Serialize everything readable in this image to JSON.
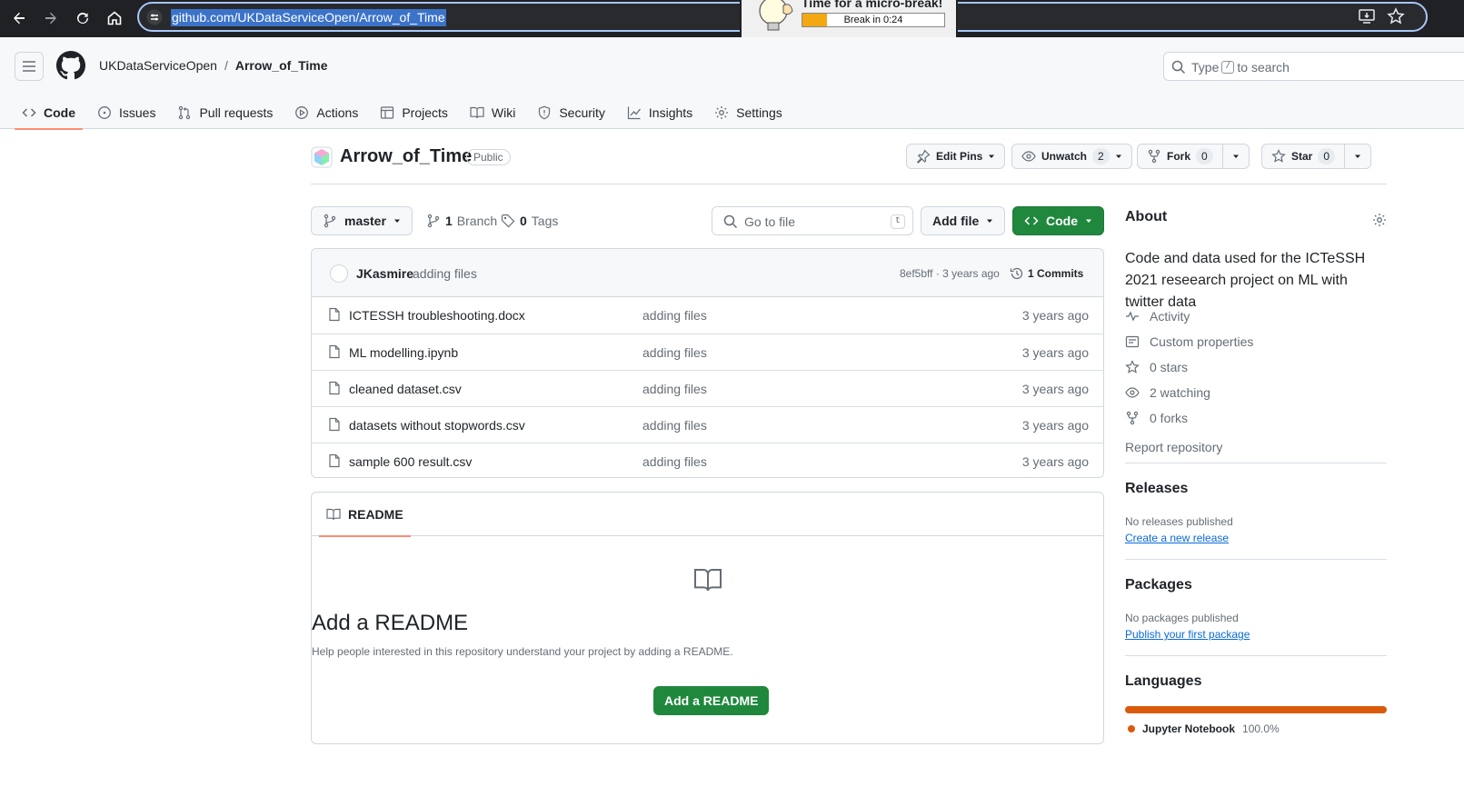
{
  "browser": {
    "url": "github.com/UKDataServiceOpen/Arrow_of_Time"
  },
  "popup": {
    "title": "Time for a micro-break!",
    "progress_text": "Break in 0:24",
    "progress_fraction": 0.17,
    "fill_color": "#f3a712"
  },
  "header": {
    "owner": "UKDataServiceOpen",
    "separator": "/",
    "repo": "Arrow_of_Time",
    "search_prefix": "Type",
    "search_key": "/",
    "search_suffix": "to search"
  },
  "tabs": [
    {
      "label": "Code",
      "icon": "code-icon",
      "active": true
    },
    {
      "label": "Issues",
      "icon": "issue-icon"
    },
    {
      "label": "Pull requests",
      "icon": "pull-request-icon"
    },
    {
      "label": "Actions",
      "icon": "play-icon"
    },
    {
      "label": "Projects",
      "icon": "table-icon"
    },
    {
      "label": "Wiki",
      "icon": "book-icon"
    },
    {
      "label": "Security",
      "icon": "shield-icon"
    },
    {
      "label": "Insights",
      "icon": "graph-icon"
    },
    {
      "label": "Settings",
      "icon": "gear-icon"
    }
  ],
  "repo": {
    "name": "Arrow_of_Time",
    "visibility": "Public",
    "edit_pins": "Edit Pins",
    "unwatch": "Unwatch",
    "watch_count": "2",
    "fork": "Fork",
    "fork_count": "0",
    "star": "Star",
    "star_count": "0"
  },
  "toolbar": {
    "branch": "master",
    "branch_count": "1",
    "branch_label": "Branch",
    "tag_count": "0",
    "tag_label": "Tags",
    "goto_placeholder": "Go to file",
    "goto_key": "t",
    "add_file": "Add file",
    "code": "Code"
  },
  "commit": {
    "author": "JKasmire",
    "message": "adding files",
    "meta": "8ef5bff · 3 years ago",
    "count": "1 Commits"
  },
  "files": [
    {
      "name": "ICTESSH troubleshooting.docx",
      "message": "adding files",
      "date": "3 years ago"
    },
    {
      "name": "ML modelling.ipynb",
      "message": "adding files",
      "date": "3 years ago"
    },
    {
      "name": "cleaned dataset.csv",
      "message": "adding files",
      "date": "3 years ago"
    },
    {
      "name": "datasets without stopwords.csv",
      "message": "adding files",
      "date": "3 years ago"
    },
    {
      "name": "sample 600 result.csv",
      "message": "adding files",
      "date": "3 years ago"
    }
  ],
  "readme": {
    "tab": "README",
    "title": "Add a README",
    "subtitle": "Help people interested in this repository understand your project by adding a README.",
    "button": "Add a README"
  },
  "about": {
    "title": "About",
    "description": "Code and data used for the ICTeSSH 2021 reseearch project on ML with twitter data",
    "items": [
      {
        "label": "Activity",
        "icon": "pulse-icon"
      },
      {
        "label": "Custom properties",
        "icon": "note-icon"
      },
      {
        "label": "0 stars",
        "icon": "star-icon"
      },
      {
        "label": "2 watching",
        "icon": "eye-icon"
      },
      {
        "label": "0 forks",
        "icon": "fork-icon"
      }
    ],
    "report": "Report repository"
  },
  "releases": {
    "title": "Releases",
    "none": "No releases published",
    "link": "Create a new release"
  },
  "packages": {
    "title": "Packages",
    "none": "No packages published",
    "link": "Publish your first package"
  },
  "languages": {
    "title": "Languages",
    "items": [
      {
        "name": "Jupyter Notebook",
        "percent": "100.0%",
        "color": "#da5b0b"
      }
    ]
  }
}
